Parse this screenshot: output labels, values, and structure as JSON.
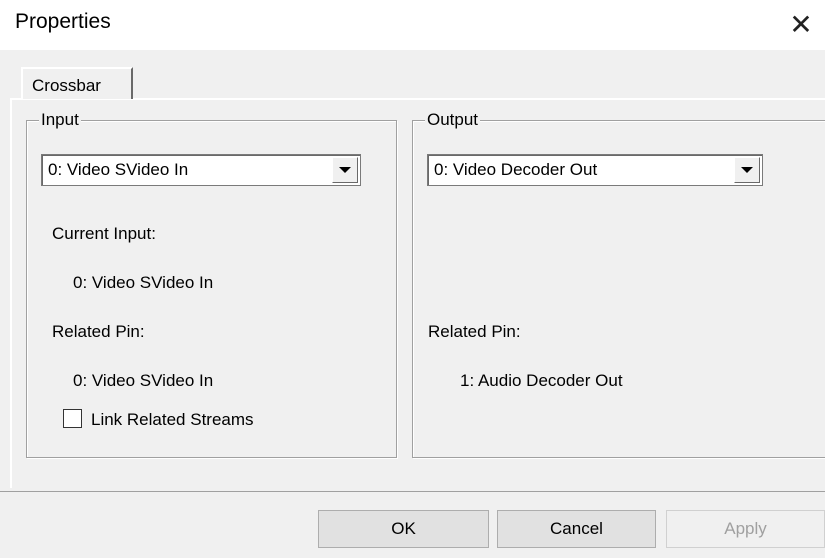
{
  "window": {
    "title": "Properties",
    "close_symbol": "✕"
  },
  "tabs": [
    {
      "label": "Crossbar",
      "selected": true
    }
  ],
  "input_group": {
    "label": "Input",
    "selected": "0: Video SVideo In",
    "current_input_label": "Current Input:",
    "current_input_value": "0: Video SVideo In",
    "related_pin_label": "Related Pin:",
    "related_pin_value": "0: Video SVideo In",
    "link_related_streams_label": "Link Related Streams",
    "link_related_streams_checked": false
  },
  "output_group": {
    "label": "Output",
    "selected": "0: Video Decoder Out",
    "related_pin_label": "Related Pin:",
    "related_pin_value": "1: Audio Decoder Out"
  },
  "buttons": {
    "ok": "OK",
    "cancel": "Cancel",
    "apply": "Apply",
    "apply_enabled": false
  },
  "icons": {
    "close": "close-icon",
    "dropdown": "chevron-down-icon",
    "checkbox": "checkbox-icon"
  }
}
